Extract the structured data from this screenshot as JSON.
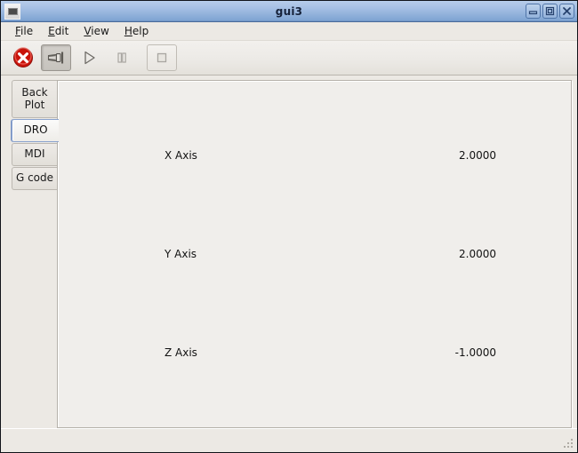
{
  "window": {
    "title": "gui3",
    "icon": "window-icon",
    "buttons": [
      {
        "name": "minimize-button",
        "label": "Minimize"
      },
      {
        "name": "maximize-button",
        "label": "Maximize"
      },
      {
        "name": "close-button",
        "label": "Close"
      }
    ]
  },
  "menubar": {
    "items": [
      {
        "mnemonic": "F",
        "rest": "ile"
      },
      {
        "mnemonic": "E",
        "rest": "dit"
      },
      {
        "mnemonic": "V",
        "rest": "iew"
      },
      {
        "mnemonic": "H",
        "rest": "elp"
      }
    ]
  },
  "toolbar": {
    "items": [
      {
        "name": "estop-button",
        "icon": "red-x-circle-icon",
        "label": "E-Stop",
        "state": "enabled"
      },
      {
        "name": "machine-power-button",
        "icon": "power-plug-icon",
        "label": "Machine Power",
        "state": "pressed"
      },
      {
        "name": "run-button",
        "icon": "play-triangle-icon",
        "label": "Run",
        "state": "disabled"
      },
      {
        "name": "pause-button",
        "icon": "pause-bars-icon",
        "label": "Pause",
        "state": "disabled"
      },
      {
        "name": "stop-button",
        "icon": "stop-square-icon",
        "label": "Stop",
        "state": "disabled"
      }
    ]
  },
  "notebook": {
    "tabs": [
      {
        "name": "tab-back-plot",
        "label": "Back\nPlot",
        "line1": "Back",
        "line2": "Plot",
        "active": false
      },
      {
        "name": "tab-dro",
        "label": "DRO",
        "line1": "DRO",
        "line2": "",
        "active": true
      },
      {
        "name": "tab-mdi",
        "label": "MDI",
        "line1": "MDI",
        "line2": "",
        "active": false
      },
      {
        "name": "tab-gcode",
        "label": "G code",
        "line1": "G code",
        "line2": "",
        "active": false
      }
    ]
  },
  "dro": {
    "axes": [
      {
        "name": "x-axis",
        "label": "X Axis",
        "value": "2.0000"
      },
      {
        "name": "y-axis",
        "label": "Y Axis",
        "value": "2.0000"
      },
      {
        "name": "z-axis",
        "label": "Z Axis",
        "value": "-1.0000"
      }
    ]
  },
  "statusbar": {
    "text": "",
    "grip": "resize-grip-icon"
  },
  "colors": {
    "title_gradient_top": "#b7cdea",
    "title_gradient_bottom": "#7ea3d2",
    "window_bg": "#ece9e4",
    "panel_bg": "#f0eeeb",
    "active_tab_border": "#8aa2cd",
    "estop_red": "#d81f16",
    "text": "#121212"
  }
}
